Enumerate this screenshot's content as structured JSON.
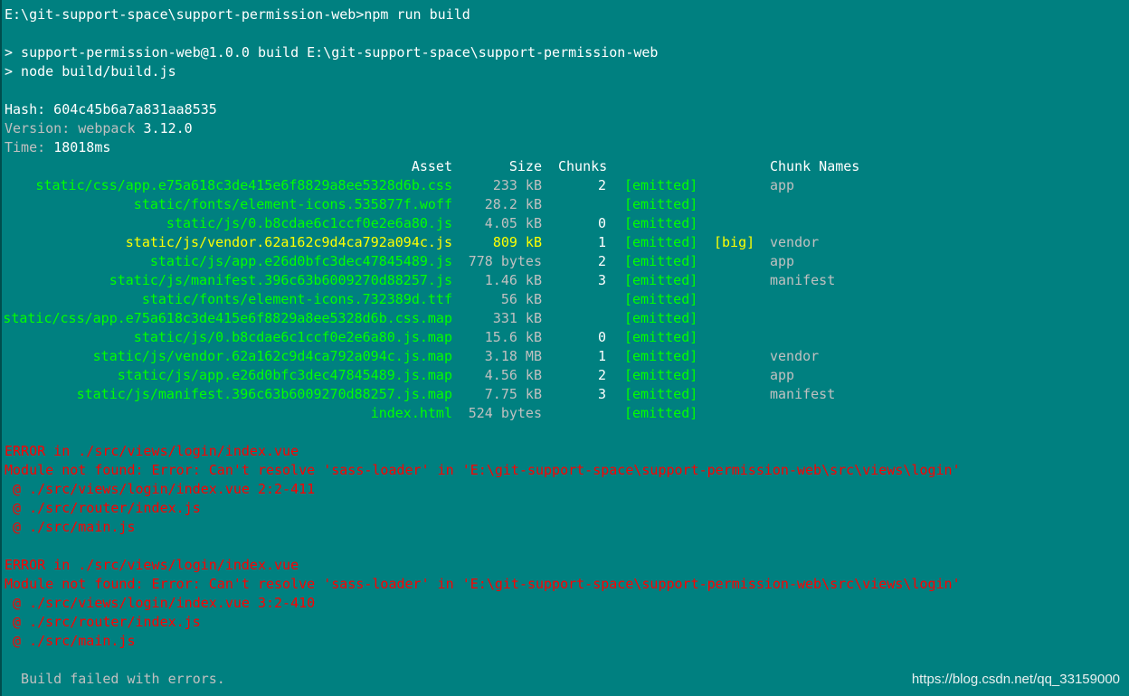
{
  "terminal": {
    "prompt": "E:\\git-support-space\\support-permission-web>npm run build",
    "script_line": "> support-permission-web@1.0.0 build E:\\git-support-space\\support-permission-web",
    "node_line": "> node build/build.js",
    "hash": "Hash: 604c45b6a7a831aa8535",
    "version_label": "Version: webpack ",
    "version_value": "3.12.0",
    "time_label": "Time: ",
    "time_value": "18018ms",
    "table_headers": {
      "asset": "Asset",
      "size": "Size",
      "chunks": "Chunks",
      "chunk_names": "Chunk Names"
    },
    "assets": [
      {
        "name": "static/css/app.e75a618c3de415e6f8829a8ee5328d6b.css",
        "size": "233 kB",
        "chunks": "2",
        "status": "[emitted]",
        "flag": "",
        "chunk_names": "app",
        "highlight": "green"
      },
      {
        "name": "static/fonts/element-icons.535877f.woff",
        "size": "28.2 kB",
        "chunks": "",
        "status": "[emitted]",
        "flag": "",
        "chunk_names": "",
        "highlight": "green"
      },
      {
        "name": "static/js/0.b8cdae6c1ccf0e2e6a80.js",
        "size": "4.05 kB",
        "chunks": "0",
        "status": "[emitted]",
        "flag": "",
        "chunk_names": "",
        "highlight": "green"
      },
      {
        "name": "static/js/vendor.62a162c9d4ca792a094c.js",
        "size": "809 kB",
        "chunks": "1",
        "status": "[emitted]",
        "flag": "[big]",
        "chunk_names": "vendor",
        "highlight": "yellow"
      },
      {
        "name": "static/js/app.e26d0bfc3dec47845489.js",
        "size": "778 bytes",
        "chunks": "2",
        "status": "[emitted]",
        "flag": "",
        "chunk_names": "app",
        "highlight": "green"
      },
      {
        "name": "static/js/manifest.396c63b6009270d88257.js",
        "size": "1.46 kB",
        "chunks": "3",
        "status": "[emitted]",
        "flag": "",
        "chunk_names": "manifest",
        "highlight": "green"
      },
      {
        "name": "static/fonts/element-icons.732389d.ttf",
        "size": "56 kB",
        "chunks": "",
        "status": "[emitted]",
        "flag": "",
        "chunk_names": "",
        "highlight": "green"
      },
      {
        "name": "static/css/app.e75a618c3de415e6f8829a8ee5328d6b.css.map",
        "size": "331 kB",
        "chunks": "",
        "status": "[emitted]",
        "flag": "",
        "chunk_names": "",
        "highlight": "green"
      },
      {
        "name": "static/js/0.b8cdae6c1ccf0e2e6a80.js.map",
        "size": "15.6 kB",
        "chunks": "0",
        "status": "[emitted]",
        "flag": "",
        "chunk_names": "",
        "highlight": "green"
      },
      {
        "name": "static/js/vendor.62a162c9d4ca792a094c.js.map",
        "size": "3.18 MB",
        "chunks": "1",
        "status": "[emitted]",
        "flag": "",
        "chunk_names": "vendor",
        "highlight": "green"
      },
      {
        "name": "static/js/app.e26d0bfc3dec47845489.js.map",
        "size": "4.56 kB",
        "chunks": "2",
        "status": "[emitted]",
        "flag": "",
        "chunk_names": "app",
        "highlight": "green"
      },
      {
        "name": "static/js/manifest.396c63b6009270d88257.js.map",
        "size": "7.75 kB",
        "chunks": "3",
        "status": "[emitted]",
        "flag": "",
        "chunk_names": "manifest",
        "highlight": "green"
      },
      {
        "name": "index.html",
        "size": "524 bytes",
        "chunks": "",
        "status": "[emitted]",
        "flag": "",
        "chunk_names": "",
        "highlight": "green"
      }
    ],
    "errors": [
      {
        "title": "ERROR in ./src/views/login/index.vue",
        "message": "Module not found: Error: Can't resolve 'sass-loader' in 'E:\\git-support-space\\support-permission-web\\src\\views\\login'",
        "trace": [
          " @ ./src/views/login/index.vue 2:2-411",
          " @ ./src/router/index.js",
          " @ ./src/main.js"
        ]
      },
      {
        "title": "ERROR in ./src/views/login/index.vue",
        "message": "Module not found: Error: Can't resolve 'sass-loader' in 'E:\\git-support-space\\support-permission-web\\src\\views\\login'",
        "trace": [
          " @ ./src/views/login/index.vue 3:2-410",
          " @ ./src/router/index.js",
          " @ ./src/main.js"
        ]
      }
    ],
    "footer": "  Build failed with errors."
  },
  "watermark": "https://blog.csdn.net/qq_33159000",
  "colors": {
    "background": "#008080",
    "text": "#ffffff",
    "muted": "#c0c0c0",
    "emitted": "#00ff00",
    "big_asset": "#ffff00",
    "error": "#ff0000"
  }
}
